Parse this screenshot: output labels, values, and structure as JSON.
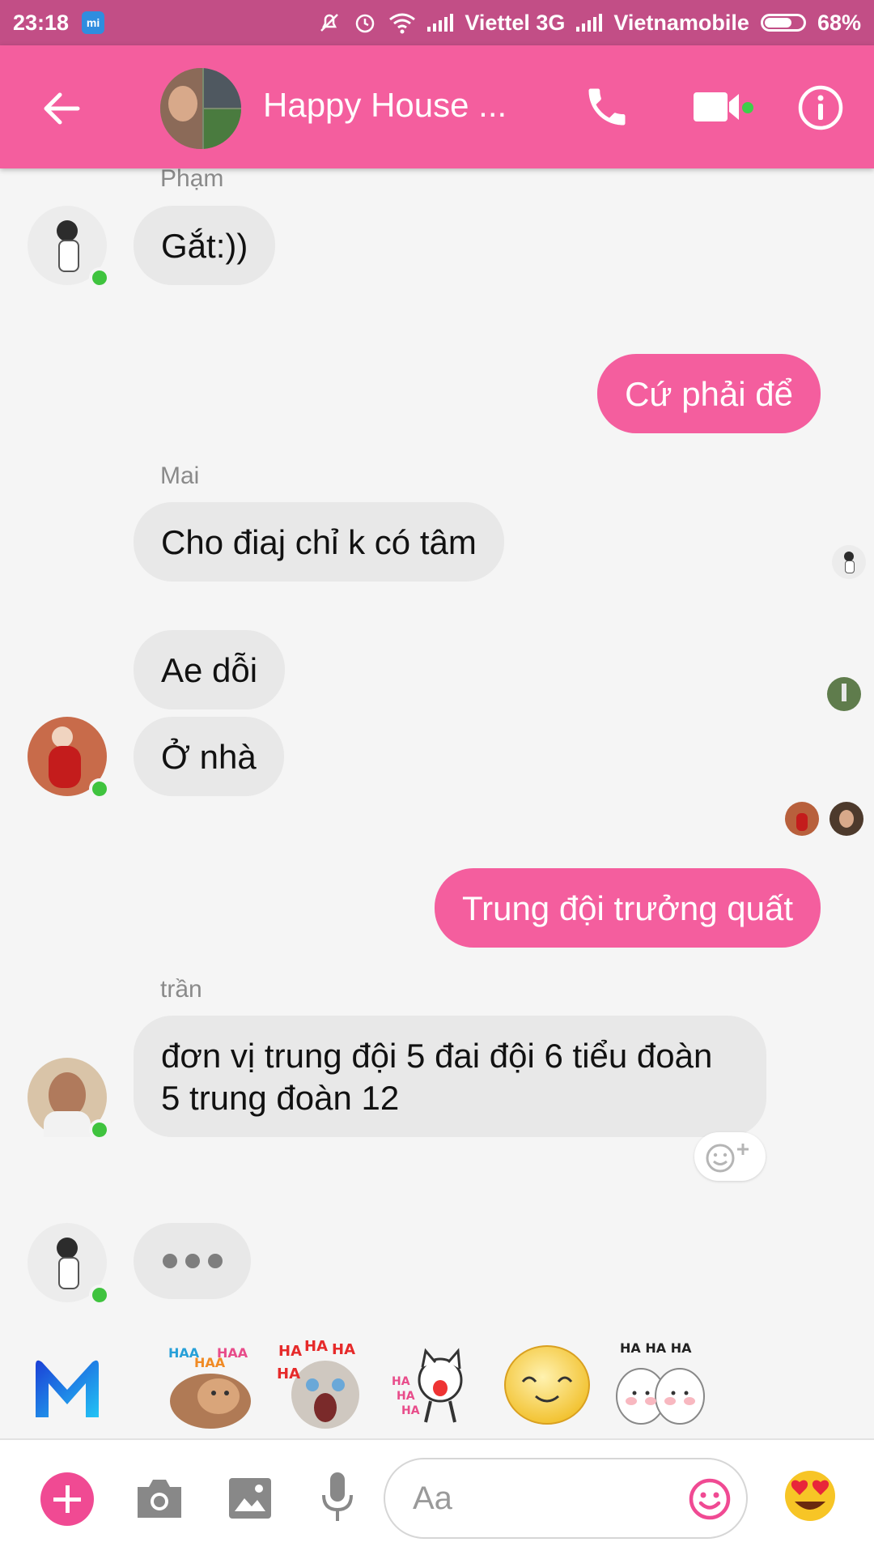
{
  "status_bar": {
    "time": "23:18",
    "carrier1": "Viettel 3G",
    "carrier2": "Vietnamobile",
    "battery": "68%",
    "battery_level": 0.68
  },
  "header": {
    "title": "Happy House ..."
  },
  "messages": [
    {
      "sender": "Phạm",
      "text": "Gắt:))"
    },
    {
      "me": true,
      "text": "Cứ phải để"
    },
    {
      "sender": "Mai",
      "text": "Cho điaj chỉ k có tâm"
    },
    {
      "text": "Ae dỗi"
    },
    {
      "text": "Ở nhà"
    },
    {
      "me": true,
      "text": "Trung đội trưởng quất"
    },
    {
      "sender": "trần",
      "text_line1": "đơn vị trung đội 5 đai đội 6 tiểu đoàn",
      "text_line2": "5 trung đoàn 12"
    }
  ],
  "composer": {
    "placeholder": "Aa"
  },
  "icons": [
    "back-arrow-icon",
    "phone-icon",
    "video-camera-icon",
    "info-icon",
    "plus-icon",
    "camera-icon",
    "gallery-icon",
    "microphone-icon",
    "smiley-icon",
    "heart-eyes-emoji-icon",
    "messenger-m-icon"
  ],
  "colors": {
    "header": "#f45e9e",
    "status_bar": "#c24e86",
    "my_bubble": "#f45e9e",
    "their_bubble": "#e8e8e8",
    "online": "#3fc33e"
  }
}
